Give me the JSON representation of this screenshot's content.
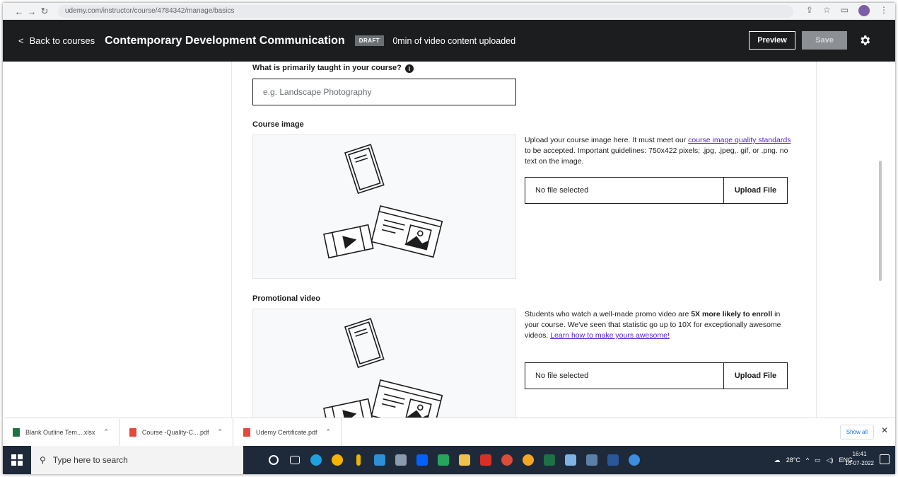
{
  "browser": {
    "url": "udemy.com/instructor/course/4784342/manage/basics"
  },
  "header": {
    "back_label": "Back to courses",
    "course_title": "Contemporary Development Communication",
    "status_badge": "DRAFT",
    "upload_status": "0min of video content uploaded",
    "preview_label": "Preview",
    "save_label": "Save"
  },
  "form": {
    "taught_label": "What is primarily taught in your course?",
    "taught_placeholder": "e.g. Landscape Photography",
    "course_image": {
      "label": "Course image",
      "desc_pre": "Upload your course image here. It must meet our ",
      "desc_link": "course image quality standards",
      "desc_post": " to be accepted. Important guidelines: 750x422 pixels; .jpg, .jpeg,. gif, or .png. no text on the image.",
      "file_status": "No file selected",
      "upload_label": "Upload File"
    },
    "promo_video": {
      "label": "Promotional video",
      "desc_pre": "Students who watch a well-made promo video are ",
      "desc_bold": "5X more likely to enroll",
      "desc_mid": " in your course. We've seen that statistic go up to 10X for exceptionally awesome videos. ",
      "desc_link": "Learn how to make yours awesome!",
      "file_status": "No file selected",
      "upload_label": "Upload File"
    }
  },
  "downloads": {
    "items": [
      {
        "name": "Blank Outline Tem....xlsx",
        "color": "#1e7145"
      },
      {
        "name": "Course -Quality-C....pdf",
        "color": "#e5483c"
      },
      {
        "name": "Udemy Certificate.pdf",
        "color": "#e5483c"
      }
    ],
    "show_all": "Show all"
  },
  "taskbar": {
    "search_placeholder": "Type here to search",
    "weather": "28°C",
    "language": "ENG",
    "time": "16:41",
    "date": "16-07-2022"
  },
  "colors": {
    "header_bg": "#1c1d1f",
    "link": "#5624d0",
    "badge": "#6a6f73"
  }
}
